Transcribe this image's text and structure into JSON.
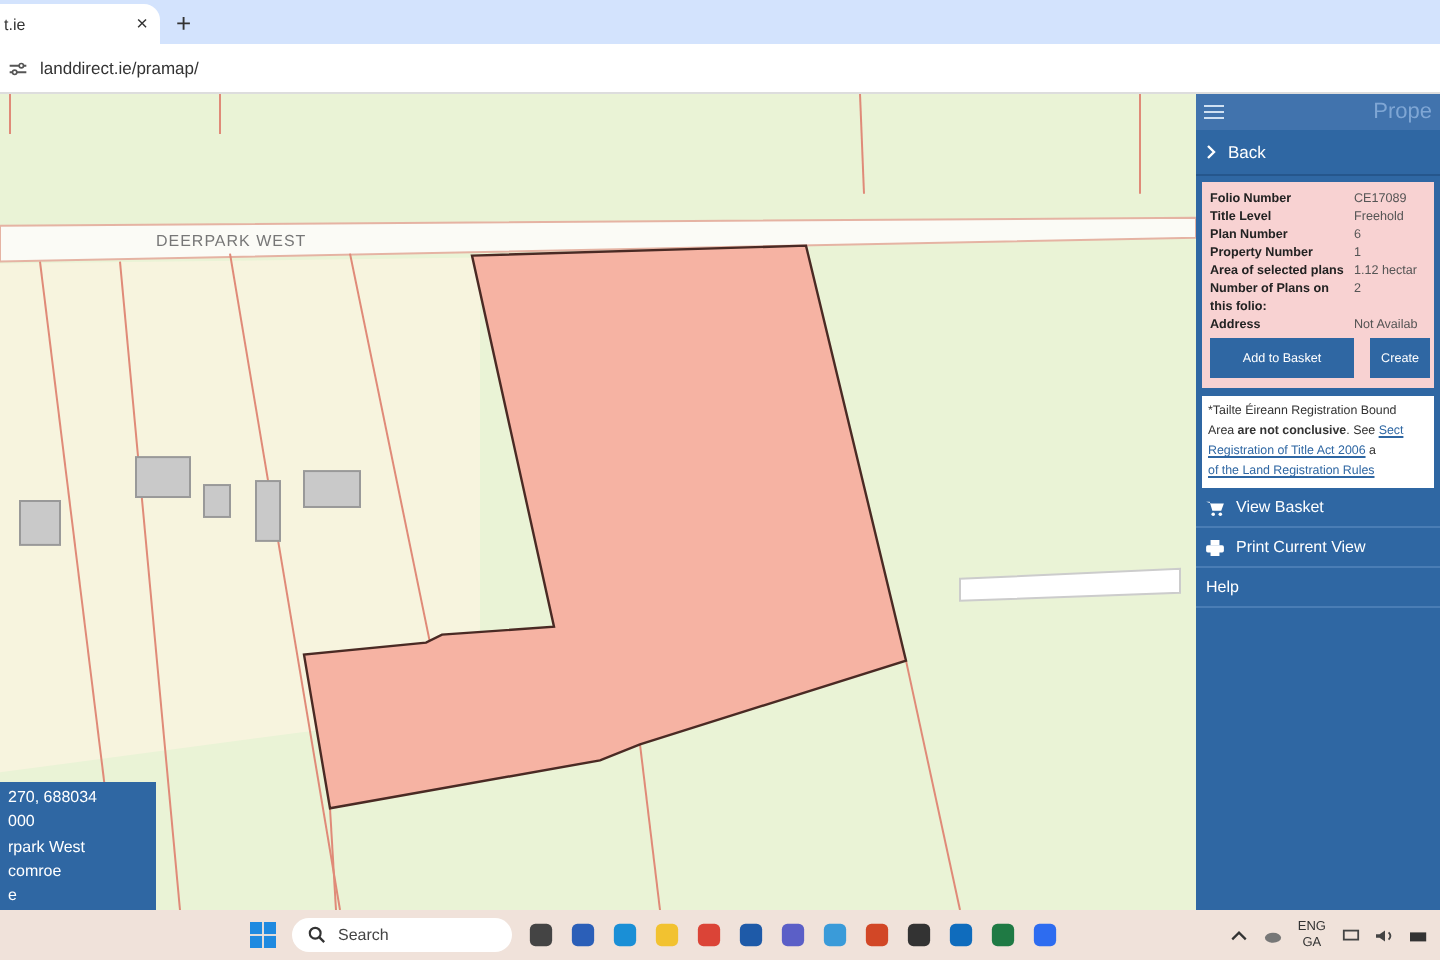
{
  "browser": {
    "tab_title": "t.ie",
    "tab_close": "×",
    "new_tab": "+",
    "address": "landdirect.ie/pramap/"
  },
  "map": {
    "place_label": "DEERPARK WEST",
    "info_lines": [
      "270, 688034",
      "000",
      "rpark West",
      "comroe",
      "e"
    ]
  },
  "panel": {
    "title": "Prope",
    "back": "Back",
    "properties": [
      {
        "label": "Folio Number",
        "value": "CE17089"
      },
      {
        "label": "Title Level",
        "value": "Freehold"
      },
      {
        "label": "Plan Number",
        "value": "6"
      },
      {
        "label": "Property Number",
        "value": "1"
      },
      {
        "label": "Area of selected plans",
        "value": "1.12 hectar"
      },
      {
        "label": "Number of Plans on this folio:",
        "value": "2"
      },
      {
        "label": "Address",
        "value": "Not Availab"
      }
    ],
    "buttons": [
      "Add to Basket",
      "Create"
    ],
    "disclaimer": [
      [
        {
          "kind": "text",
          "text": "*Tailte Éireann Registration Bound"
        }
      ],
      [
        {
          "kind": "text",
          "text": "Area **are not conclusive**. See "
        },
        {
          "kind": "link",
          "text": "Sect"
        }
      ],
      [
        {
          "kind": "link",
          "text": "Registration of Title Act 2006"
        },
        {
          "kind": "text",
          "text": " a"
        }
      ],
      [
        {
          "kind": "link",
          "text": "of the Land Registration Rules"
        }
      ]
    ],
    "menu": [
      {
        "kind": "basket",
        "label": "View Basket"
      },
      {
        "kind": "print",
        "label": "Print Current View"
      },
      {
        "kind": "plain",
        "label": "Help"
      }
    ]
  },
  "taskbar": {
    "search_placeholder": "Search",
    "language": [
      "ENG",
      "GA"
    ]
  }
}
